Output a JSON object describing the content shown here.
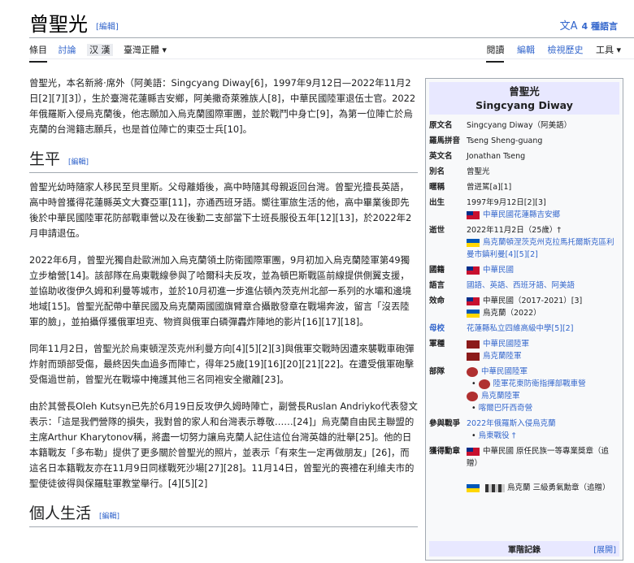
{
  "header": {
    "title": "曾聖光",
    "edit": "[編輯]",
    "languages": "4 種語言"
  },
  "tabs": {
    "left": [
      "條目",
      "討論",
      "汉 漢",
      "臺灣正體 ▾"
    ],
    "right": [
      "閱讀",
      "編輯",
      "檢視歷史",
      "工具 ▾"
    ]
  },
  "sections": {
    "bio": "生平",
    "personal": "個人生活",
    "edit": "[編輯]"
  },
  "infobox": {
    "name_zh": "曾聖光",
    "name_en": "Singcyang Diway",
    "rows": [
      {
        "k": "原文名",
        "v": "Singcyang Diway（阿美語）"
      },
      {
        "k": "羅馬拼音",
        "v": "Tseng Sheng-guang"
      },
      {
        "k": "英文名",
        "v": "Jonathan Tseng"
      },
      {
        "k": "別名",
        "v": "曾聖光"
      },
      {
        "k": "暱稱",
        "v": "曾迸駡[a][1]"
      },
      {
        "k": "出生",
        "v": "1997年9月12日[2][3]"
      },
      {
        "k": "逝世",
        "v": "2022年11月2日（25歲）†"
      },
      {
        "k": "國籍",
        "v": "中華民國"
      },
      {
        "k": "語言",
        "v": "國語、英語、西班牙語、阿美語"
      },
      {
        "k": "效命",
        "v": "中華民國（2017-2021）[3]"
      },
      {
        "k": "母校",
        "v": "花蓮縣私立四維高級中學[5][2]"
      },
      {
        "k": "軍種",
        "v": "中華民國陸軍"
      },
      {
        "k": "部隊",
        "v": "中華民國陸軍"
      },
      {
        "k": "參與戰爭",
        "v": "2022年俄羅斯入侵烏克蘭"
      },
      {
        "k": "獲得勳章",
        "v": "中華民國 原任民族一等專業獎章（追贈）"
      }
    ],
    "birth_place": "中華民國花蓮縣吉安鄉",
    "death_place": "烏克蘭頓涅茨克州克拉馬托爾斯克區利曼市鎮利曼[4][5][2]",
    "serve_ua": "烏克蘭（2022）",
    "branch_ua": "烏克蘭陸軍",
    "unit_line2": "陸軍花東防衛指揮部戰車營",
    "unit_line3": "烏克蘭陸軍",
    "unit_line4": "喀爾巴阡西奇營",
    "war2": "烏東戰役 †",
    "medal_ua": "烏克蘭 三級勇氣勳章（追贈）",
    "footer": "軍階記錄",
    "footer_toggle": "[展開]"
  },
  "body": {
    "p1": "曾聖光，本名新將·席外（阿美語：Singcyang Diway[6]，1997年9月12日—2022年11月2日[2][7][3]），生於臺灣花蓮縣吉安鄉，阿美撒奇萊雅族人[8]，中華民國陸軍退伍士官。2022年俄羅斯入侵烏克蘭後，他志願加入烏克蘭國際軍團，並於戰鬥中身亡[9]，為第一位陣亡於烏克蘭的台灣籍志願兵，也是首位陣亡的東亞士兵[10]。",
    "p2": "曾聖光幼時隨家人移民至貝里斯。父母離婚後，高中時隨其母親返回台灣。曾聖光擅長英語，高中時曾獲得花蓮縣英文大賽亞軍[11]，亦通西班牙語。嚮往軍旅生活的他，高中畢業後即先後於中華民國陸軍花防部戰車營以及在後勤二支部當下士班長服役五年[12][13]，於2022年2月申請退伍。",
    "p3": "2022年6月，曾聖光獨自赴歐洲加入烏克蘭領土防衛國際軍團，9月初加入烏克蘭陸軍第49獨立步槍營[14]。該部隊在烏東戰線參與了哈爾科夫反攻，並為頓巴斯戰區前線提供側翼支援，並協助收復伊久姆和利曼等城市，並於10月初進一步進佔頓內茨克州北部一系列的水壩和邊境地域[15]。曾聖光配帶中華民國及烏克蘭兩國國旗臂章合攝散發章在戰場奔波，留言「沒丟陸軍的臉」，並拍攝俘獲俄軍坦克、物資與俄軍白磷彈轟炸陣地的影片[16][17][18]。",
    "p4": "同年11月2日，曾聖光於烏東頓涅茨克州利曼方向[4][5][2][3]與俄軍交戰時因遭來襲戰車砲彈炸射而頭部受傷，最終因失血過多而陣亡，得年25歲[19][16][20][21][22]。在遭受俄軍砲擊受傷過世前，曾聖光在戰壕中掩護其他三名同袍安全撤離[23]。",
    "p5": "由於其營長Oleh Kutsyn已先於6月19日反攻伊久姆時陣亡，副營長Ruslan Andriyko代表發文表示：「這是我們營隊的損失，我對曾的家人和台灣表示尊敬……[24]」烏克蘭自由民主聯盟的主席Arthur Kharytonov稱，將盡一切努力讓烏克蘭人記住這位台灣英雄的壯舉[25]。他的日本籍戰友「多布勒」提供了更多關於曾聖光的照片，並表示「有來生一定再做朋友」[26]，而這名日本籍戰友亦在11月9日同樣戰死沙場[27][28]。11月14日，曾聖光的喪禮在利維夫市的聖使徒彼得與保羅駐軍教堂舉行。[4][5][2]"
  }
}
